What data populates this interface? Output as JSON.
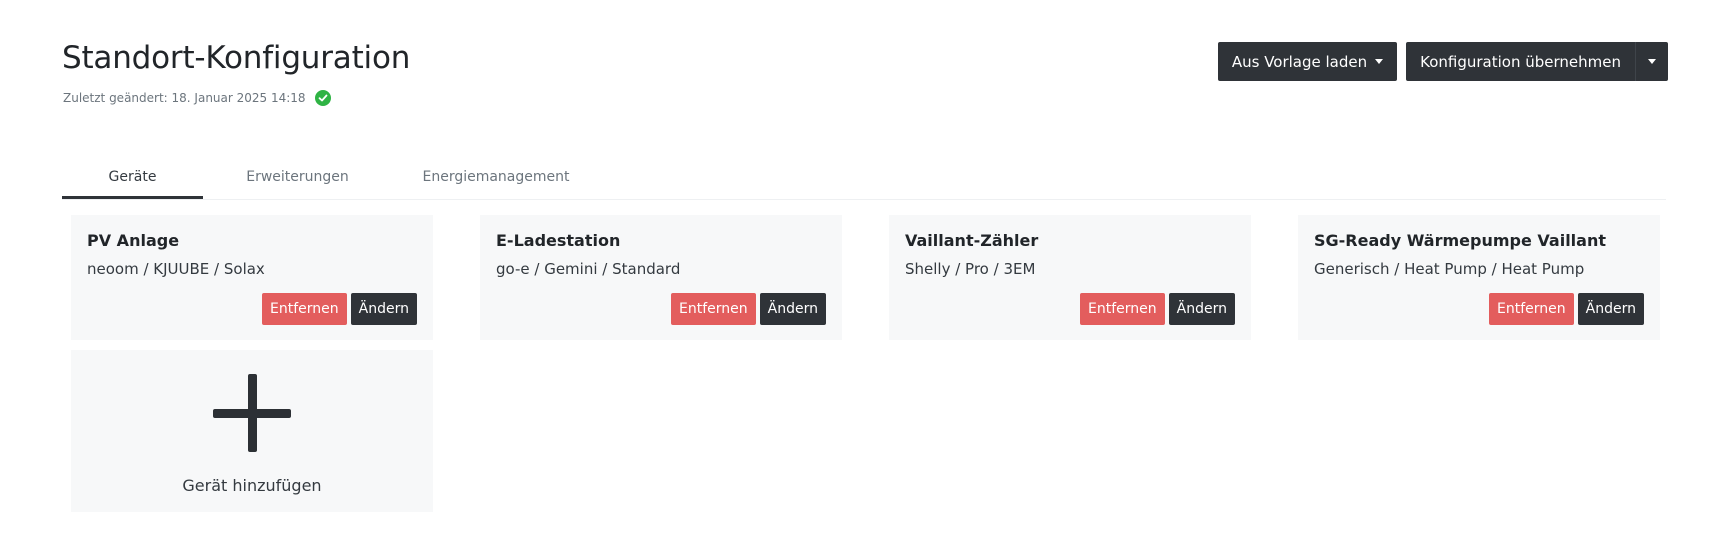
{
  "header": {
    "title": "Standort-Konfiguration",
    "last_modified": "Zuletzt geändert: 18. Januar 2025 14:18",
    "status_color": "#2fb344",
    "actions": {
      "load_template_label": "Aus Vorlage laden",
      "apply_config_label": "Konfiguration übernehmen"
    }
  },
  "tabs": [
    {
      "label": "Geräte",
      "active": true
    },
    {
      "label": "Erweiterungen",
      "active": false
    },
    {
      "label": "Energiemanagement",
      "active": false
    }
  ],
  "devices": [
    {
      "title": "PV Anlage",
      "subtitle": "neoom / KJUUBE / Solax",
      "remove_label": "Entfernen",
      "edit_label": "Ändern"
    },
    {
      "title": "E-Ladestation",
      "subtitle": "go-e / Gemini / Standard",
      "remove_label": "Entfernen",
      "edit_label": "Ändern"
    },
    {
      "title": "Vaillant-Zähler",
      "subtitle": "Shelly / Pro / 3EM",
      "remove_label": "Entfernen",
      "edit_label": "Ändern"
    },
    {
      "title": "SG-Ready Wärmepumpe Vaillant",
      "subtitle": "Generisch / Heat Pump / Heat Pump",
      "remove_label": "Entfernen",
      "edit_label": "Ändern"
    }
  ],
  "add_device": {
    "label": "Gerät hinzufügen",
    "icon": "plus-icon"
  },
  "colors": {
    "danger": "#e35d5d",
    "dark": "#2f3338",
    "card_bg": "#f7f8f9"
  }
}
